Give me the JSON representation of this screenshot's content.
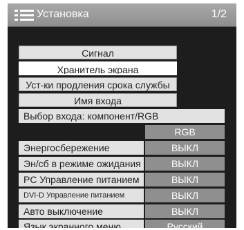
{
  "header": {
    "title": "Установка",
    "page": "1/2",
    "icon": "menu-list-icon"
  },
  "buttons": [
    {
      "label": "Сигнал",
      "selected": false
    },
    {
      "label": "Хранитель экрана",
      "selected": true
    },
    {
      "label": "Уст-ки продления срока службы",
      "selected": false
    },
    {
      "label": "Имя входа",
      "selected": false
    }
  ],
  "input_select": {
    "label": "Выбор входа: компонент/RGB",
    "value": "RGB"
  },
  "settings": [
    {
      "label": "Энергосбережение",
      "value": "ВЫКЛ"
    },
    {
      "label": "Эн/сб в режиме ожидания",
      "value": "ВЫКЛ"
    },
    {
      "label": "PC Управление питанием",
      "value": "ВЫКЛ"
    },
    {
      "label": "DVI-D Управление питанием",
      "value": "ВЫКЛ"
    },
    {
      "label": "Авто выключение",
      "value": "ВЫКЛ"
    },
    {
      "label": "Язык экранного меню",
      "value": "Русский"
    }
  ],
  "colors": {
    "panel": "#1d1d1d",
    "header": "#9b9b9b",
    "item": "#e2e2e2",
    "value": "#8f8f8f",
    "selected": "#ffffff"
  }
}
